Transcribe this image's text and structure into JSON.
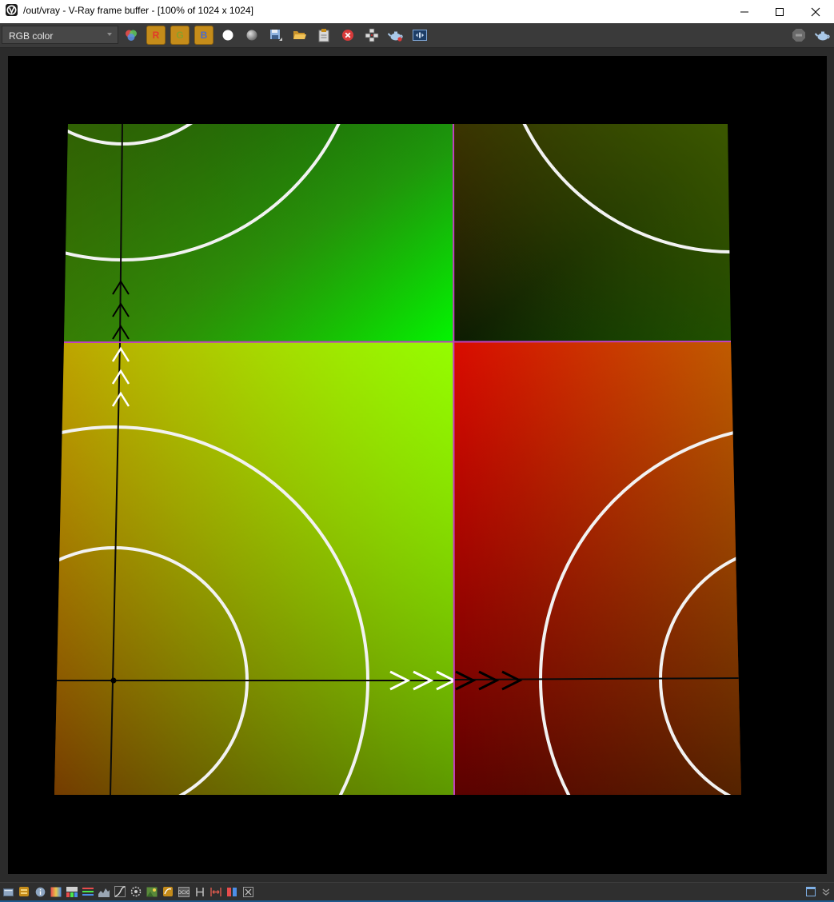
{
  "window": {
    "title": "/out/vray - V-Ray frame buffer - [100% of 1024 x 1024]",
    "controls": [
      "minimize",
      "maximize",
      "close"
    ]
  },
  "toolbar": {
    "channel_select": "RGB color",
    "channel_buttons": [
      {
        "label": "R",
        "color": "#d9a03a"
      },
      {
        "label": "G",
        "color": "#d9a03a"
      },
      {
        "label": "B",
        "color": "#d9a03a"
      }
    ],
    "icons": [
      "color-channels-icon",
      "white-circle-icon",
      "gray-sphere-icon",
      "save-image-icon",
      "open-image-icon",
      "clear-image-icon",
      "clear-close-icon",
      "track-mouse-icon",
      "render-teapot-icon",
      "render-region-icon",
      "stop-render-icon",
      "render-teapot-icon"
    ]
  },
  "render": {
    "resolution": "1024 x 1024",
    "zoom": "100%",
    "quadrants": {
      "top_left": {
        "colors": [
          "#0a3a0a",
          "#00ff00"
        ]
      },
      "top_right": {
        "colors": [
          "#000000",
          "#3a5a00"
        ]
      },
      "bottom_left": {
        "colors": [
          "#ff7a00",
          "#ffff00",
          "#4a6a00",
          "#66ff00"
        ]
      },
      "bottom_right": {
        "colors": [
          "#ff0000",
          "#ff6a00",
          "#550000",
          "#4a5a00"
        ]
      }
    }
  },
  "statusbar": {
    "icons": [
      "open-folder-icon",
      "layers-icon",
      "info-icon",
      "color-corrections-icon",
      "hsl-icon",
      "levels-icon",
      "histogram-icon",
      "curves-icon",
      "lens-effects-icon",
      "background-image-icon",
      "lut-icon",
      "ocio-icon",
      "h-icon",
      "compare-icon",
      "stereo-icon",
      "pixel-info-icon"
    ],
    "right_icons": [
      "window-icon",
      "expand-down-icon"
    ]
  }
}
